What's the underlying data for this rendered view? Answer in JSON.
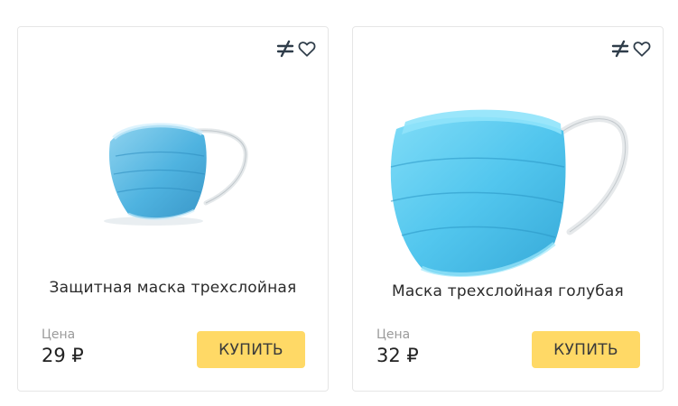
{
  "accent_color": "#ffd966",
  "products": [
    {
      "name": "Защитная маска трехслойная",
      "price_label": "Цена",
      "price": "29 ₽",
      "buy_label": "КУПИТЬ",
      "icons": [
        "compare-icon",
        "heart-icon"
      ]
    },
    {
      "name": "Маска трехслойная голубая",
      "price_label": "Цена",
      "price": "32 ₽",
      "buy_label": "КУПИТЬ",
      "icons": [
        "compare-icon",
        "heart-icon"
      ]
    }
  ]
}
